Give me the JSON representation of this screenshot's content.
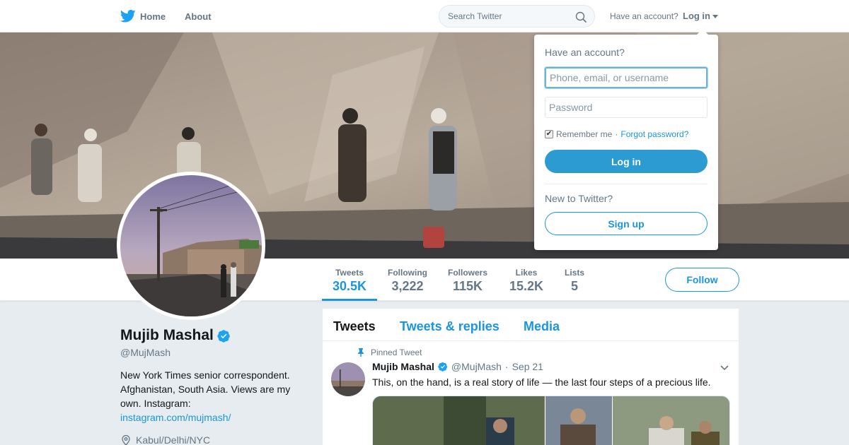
{
  "nav": {
    "home_label": "Home",
    "about_label": "About",
    "search_placeholder": "Search Twitter",
    "have_account": "Have an account?",
    "login_label": "Log in",
    "logo_icon": "twitter-bird-icon",
    "brand_color": "#1da1f2"
  },
  "login_dropdown": {
    "title": "Have an account?",
    "username_placeholder": "Phone, email, or username",
    "password_placeholder": "Password",
    "remember_me": "Remember me",
    "separator": "·",
    "forgot_password": "Forgot password?",
    "login_button": "Log in",
    "new_to_twitter": "New to Twitter?",
    "signup_button": "Sign up",
    "remember_checked": true
  },
  "stats": {
    "items": [
      {
        "label": "Tweets",
        "value": "30.5K",
        "active": true
      },
      {
        "label": "Following",
        "value": "3,222",
        "active": false
      },
      {
        "label": "Followers",
        "value": "115K",
        "active": false
      },
      {
        "label": "Likes",
        "value": "15.2K",
        "active": false
      },
      {
        "label": "Lists",
        "value": "5",
        "active": false
      }
    ],
    "follow_button": "Follow"
  },
  "profile": {
    "name": "Mujib Mashal",
    "handle": "@MujMash",
    "bio": "New York Times senior correspondent. Afghanistan, South Asia. Views are my own. Instagram:",
    "bio_link": "instagram.com/mujmash/",
    "location": "Kabul/Delhi/NYC",
    "verified": true
  },
  "timeline": {
    "tabs": [
      {
        "label": "Tweets",
        "active": true
      },
      {
        "label": "Tweets & replies",
        "active": false
      },
      {
        "label": "Media",
        "active": false
      }
    ],
    "pinned_label": "Pinned Tweet",
    "tweet": {
      "name": "Mujib Mashal",
      "handle": "@MujMash",
      "separator": "·",
      "date": "Sep 21",
      "text": "This, on the hand, is a real story of life — the last four steps of a precious life."
    }
  },
  "colors": {
    "accent": "#1b95e0",
    "login_button": "#2b9bd1",
    "background": "#e6ecf0"
  }
}
